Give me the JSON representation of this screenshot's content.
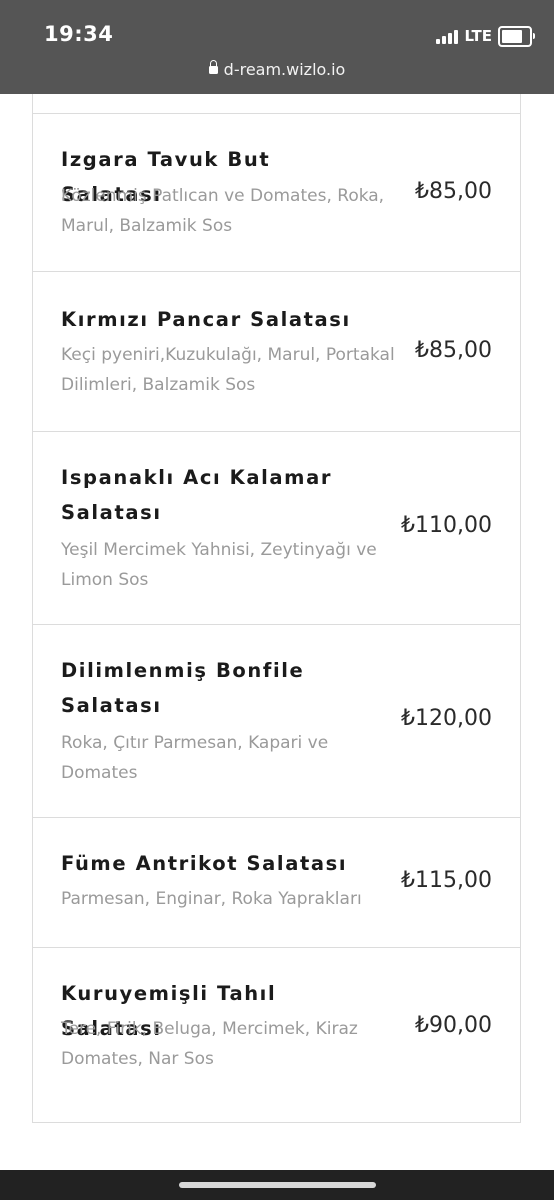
{
  "status_bar": {
    "time": "19:34",
    "network": "LTE",
    "signal_icon": "cellular-signal-icon",
    "battery_icon": "battery-icon"
  },
  "browser": {
    "url": "d-ream.wizlo.io",
    "lock_icon": "lock-icon"
  },
  "menu": {
    "items": [
      {
        "name": "Izgara Tavuk But Salatası",
        "description": "Közlenmiş Patlıcan ve Domates, Roka, Marul, Balzamik Sos",
        "price": "₺85,00"
      },
      {
        "name": "Kırmızı Pancar Salatası",
        "description": "Keçi pyeniri,Kuzukulağı, Marul, Portakal Dilimleri, Balzamik Sos",
        "price": "₺85,00"
      },
      {
        "name": "Ispanaklı Acı Kalamar Salatası",
        "description": "Yeşil Mercimek Yahnisi, Zeytinyağı ve Limon Sos",
        "price": "₺110,00"
      },
      {
        "name": "Dilimlenmiş Bonfile Salatası",
        "description": "Roka, Çıtır Parmesan, Kapari ve Domates",
        "price": "₺120,00"
      },
      {
        "name": "Füme Antrikot Salatası",
        "description": "Parmesan, Enginar, Roka Yaprakları",
        "price": "₺115,00"
      },
      {
        "name": "Kuruyemişli Tahıl Salatası",
        "description": "Tere, Firik, Beluga, Mercimek, Kiraz Domates, Nar Sos",
        "price": "₺90,00"
      }
    ]
  }
}
